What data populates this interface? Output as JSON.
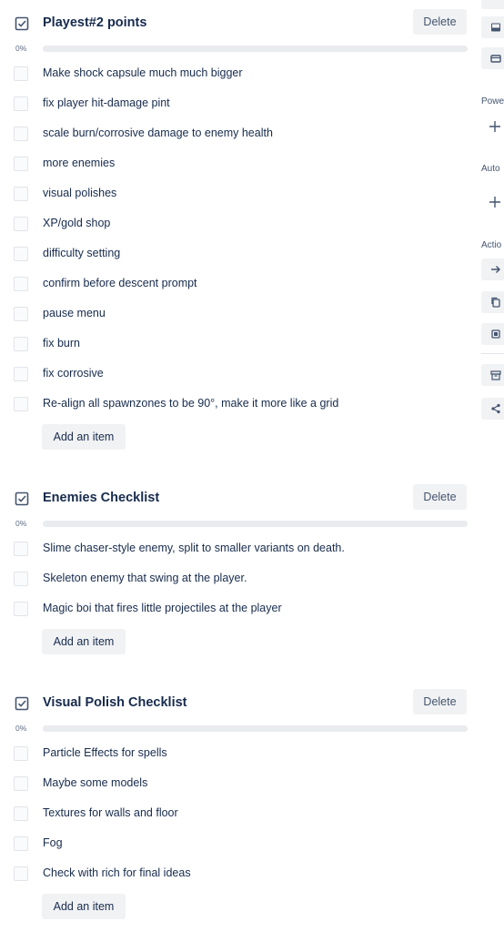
{
  "checklists": [
    {
      "title": "Playest#2 points",
      "delete_label": "Delete",
      "percent": "0%",
      "progress": 0,
      "add_label": "Add an item",
      "items": [
        "Make shock capsule much much bigger",
        "fix player hit-damage pint",
        "scale burn/corrosive damage to enemy health",
        "more enemies",
        "visual polishes",
        "XP/gold shop",
        "difficulty setting",
        "confirm before descent prompt",
        "pause menu",
        "fix burn",
        "fix corrosive",
        "Re-align all spawnzones to be 90°, make it more like a grid"
      ]
    },
    {
      "title": "Enemies Checklist",
      "delete_label": "Delete",
      "percent": "0%",
      "progress": 0,
      "add_label": "Add an item",
      "items": [
        "Slime chaser-style enemy, split to smaller variants on death.",
        "Skeleton enemy that swing at the player.",
        "Magic boi that fires little projectiles at the player"
      ]
    },
    {
      "title": "Visual Polish Checklist",
      "delete_label": "Delete",
      "percent": "0%",
      "progress": 0,
      "add_label": "Add an item",
      "items": [
        "Particle Effects for spells",
        "Maybe some models",
        "Textures for walls and floor",
        "Fog",
        "Check with rich for final ideas"
      ]
    }
  ],
  "sidebar": {
    "power_ups_label": "Powe",
    "automation_label": "Auto",
    "actions_label": "Actio",
    "icons": [
      "cover-icon",
      "attachment-icon",
      "add-power-up-icon",
      "add-automation-icon",
      "move-icon",
      "copy-icon",
      "template-icon",
      "archive-icon",
      "share-icon"
    ]
  },
  "colors": {
    "button_bg": "#f1f2f4",
    "progress_track": "#e9ebee",
    "text": "#172b4d"
  }
}
